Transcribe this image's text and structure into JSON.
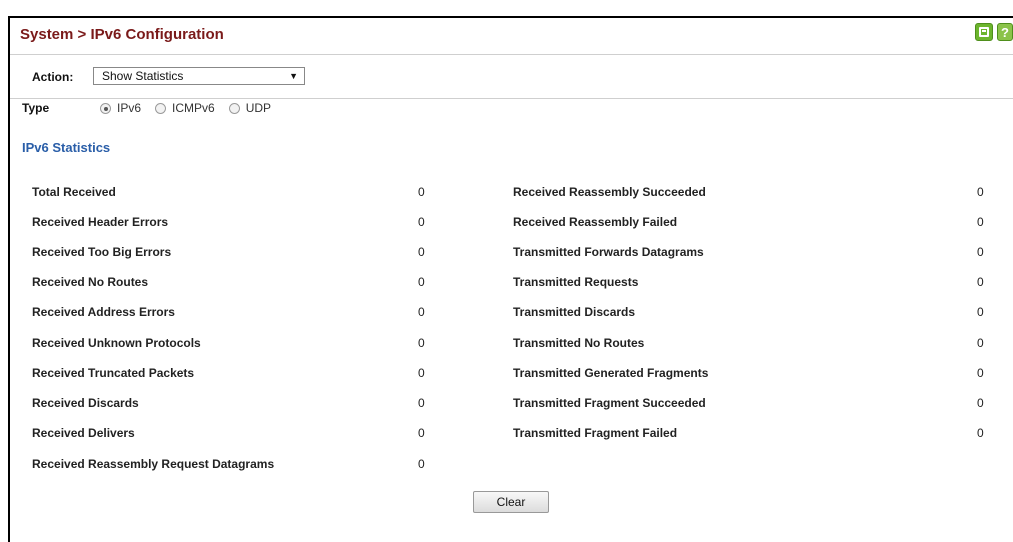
{
  "header": {
    "title": "System > IPv6 Configuration",
    "save_icon": "save-icon",
    "help_icon": "help-icon",
    "help_glyph": "?"
  },
  "action": {
    "label": "Action:",
    "selected": "Show Statistics"
  },
  "type": {
    "label": "Type",
    "options": [
      {
        "label": "IPv6",
        "checked": true
      },
      {
        "label": "ICMPv6",
        "checked": false
      },
      {
        "label": "UDP",
        "checked": false
      }
    ]
  },
  "section_title": "IPv6 Statistics",
  "left_stats": [
    {
      "label": "Total Received",
      "value": "0"
    },
    {
      "label": "Received Header Errors",
      "value": "0"
    },
    {
      "label": "Received Too Big Errors",
      "value": "0"
    },
    {
      "label": "Received No Routes",
      "value": "0"
    },
    {
      "label": "Received Address Errors",
      "value": "0"
    },
    {
      "label": "Received Unknown Protocols",
      "value": "0"
    },
    {
      "label": "Received Truncated Packets",
      "value": "0"
    },
    {
      "label": "Received Discards",
      "value": "0"
    },
    {
      "label": "Received Delivers",
      "value": "0"
    },
    {
      "label": "Received Reassembly Request Datagrams",
      "value": "0"
    }
  ],
  "right_stats": [
    {
      "label": "Received Reassembly Succeeded",
      "value": "0"
    },
    {
      "label": "Received Reassembly Failed",
      "value": "0"
    },
    {
      "label": "Transmitted Forwards Datagrams",
      "value": "0"
    },
    {
      "label": "Transmitted Requests",
      "value": "0"
    },
    {
      "label": "Transmitted Discards",
      "value": "0"
    },
    {
      "label": "Transmitted No Routes",
      "value": "0"
    },
    {
      "label": "Transmitted Generated Fragments",
      "value": "0"
    },
    {
      "label": "Transmitted Fragment Succeeded",
      "value": "0"
    },
    {
      "label": "Transmitted Fragment Failed",
      "value": "0"
    }
  ],
  "clear_label": "Clear",
  "colors": {
    "title": "#7a1a1a",
    "section": "#2a5ea8",
    "icon_green": "#6cb52d"
  }
}
